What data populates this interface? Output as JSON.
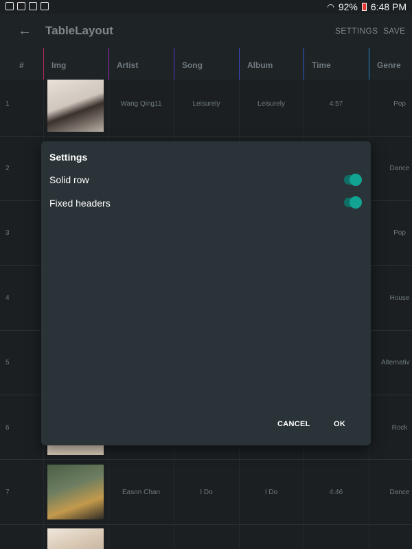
{
  "status": {
    "battery": "92%",
    "time": "6:48 PM"
  },
  "appbar": {
    "title": "TableLayout",
    "settings_label": "SETTINGS",
    "save_label": "SAVE"
  },
  "table": {
    "headers": [
      "#",
      "Img",
      "Artist",
      "Song",
      "Album",
      "Time",
      "Genre"
    ],
    "header_colors": [
      "#1e2326",
      "#b5265a",
      "#9b2db5",
      "#5a3bc2",
      "#3c46c9",
      "#2f61d1",
      "#1f86d6"
    ],
    "rows": [
      {
        "num": "1",
        "artist": "Wang Qing11",
        "song": "Leisurely",
        "album": "Leisurely",
        "time": "4:57",
        "genre": "Pop"
      },
      {
        "num": "2",
        "artist": "",
        "song": "",
        "album": "",
        "time": "",
        "genre": "Dance"
      },
      {
        "num": "3",
        "artist": "",
        "song": "",
        "album": "",
        "time": "",
        "genre": "Pop"
      },
      {
        "num": "4",
        "artist": "",
        "song": "",
        "album": "",
        "time": "",
        "genre": "House"
      },
      {
        "num": "5",
        "artist": "",
        "song": "",
        "album": "",
        "time": "",
        "genre": "Alternativ"
      },
      {
        "num": "6",
        "artist": "",
        "song": "",
        "album": "",
        "time": "",
        "genre": "Rock"
      },
      {
        "num": "7",
        "artist": "Eason Chan",
        "song": "I Do",
        "album": "I Do",
        "time": "4:46",
        "genre": "Dance"
      }
    ]
  },
  "dialog": {
    "title": "Settings",
    "options": [
      {
        "label": "Solid row",
        "checked": true
      },
      {
        "label": "Fixed headers",
        "checked": true
      }
    ],
    "cancel_label": "CANCEL",
    "ok_label": "OK",
    "accent": "#13a393"
  }
}
